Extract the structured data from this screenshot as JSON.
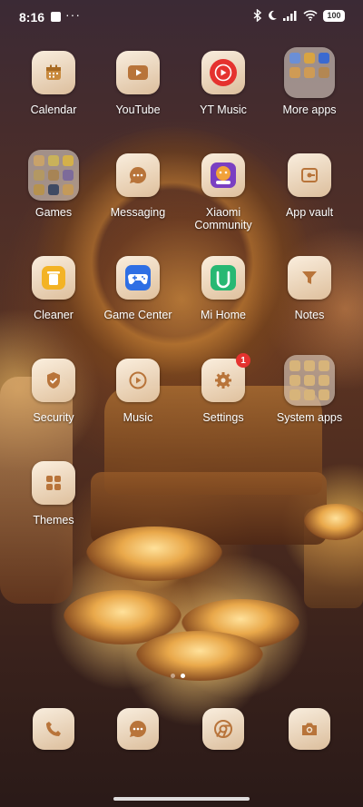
{
  "status_bar": {
    "time": "8:16",
    "dots": "···",
    "battery": "100"
  },
  "apps": [
    {
      "name": "Calendar",
      "icon": "calendar-icon"
    },
    {
      "name": "YouTube",
      "icon": "youtube-icon"
    },
    {
      "name": "YT Music",
      "icon": "yt-music-icon"
    },
    {
      "name": "More apps",
      "icon": "folder-icon"
    },
    {
      "name": "Games",
      "icon": "folder-icon"
    },
    {
      "name": "Messaging",
      "icon": "message-icon"
    },
    {
      "name": "Xiaomi Community",
      "icon": "xiaomi-community-icon"
    },
    {
      "name": "App vault",
      "icon": "app-vault-icon"
    },
    {
      "name": "Cleaner",
      "icon": "trash-icon"
    },
    {
      "name": "Game Center",
      "icon": "gamepad-icon"
    },
    {
      "name": "Mi Home",
      "icon": "mi-home-icon"
    },
    {
      "name": "Notes",
      "icon": "notes-icon"
    },
    {
      "name": "Security",
      "icon": "shield-icon"
    },
    {
      "name": "Music",
      "icon": "play-icon"
    },
    {
      "name": "Settings",
      "icon": "gear-icon",
      "badge": "1"
    },
    {
      "name": "System apps",
      "icon": "folder-icon"
    },
    {
      "name": "Themes",
      "icon": "grid-icon"
    }
  ],
  "dock": [
    {
      "icon": "phone-icon"
    },
    {
      "icon": "message-icon"
    },
    {
      "icon": "chrome-icon"
    },
    {
      "icon": "camera-icon"
    }
  ],
  "colors": {
    "accent_red": "#e5322f",
    "tile_bg": "#f3e6d4",
    "folder_bg": "#ebe1d7"
  },
  "pages": {
    "count": 2,
    "active": 2
  }
}
